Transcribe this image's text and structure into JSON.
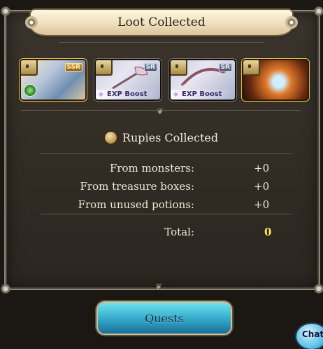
{
  "panel": {
    "title": "Loot Collected"
  },
  "loot": [
    {
      "rarity": "SSR",
      "exp_tag": "",
      "style": "character"
    },
    {
      "rarity": "SR",
      "exp_tag": "EXP Boost",
      "style": "weapon"
    },
    {
      "rarity": "SR",
      "exp_tag": "EXP Boost",
      "style": "weapon"
    },
    {
      "rarity": "",
      "exp_tag": "",
      "style": "summon"
    }
  ],
  "rupies": {
    "heading": "Rupies Collected",
    "rows": [
      {
        "label": "From monsters:",
        "value": "+0"
      },
      {
        "label": "From treasure boxes:",
        "value": "+0"
      },
      {
        "label": "From unused potions:",
        "value": "+0"
      }
    ],
    "total_label": "Total:",
    "total_value": "0"
  },
  "actions": {
    "quests_label": "Quests",
    "chat_label": "Chat"
  },
  "colors": {
    "accent_gold": "#ffe55a",
    "button_blue": "#32a7c8",
    "panel_bg": "#312b24"
  }
}
